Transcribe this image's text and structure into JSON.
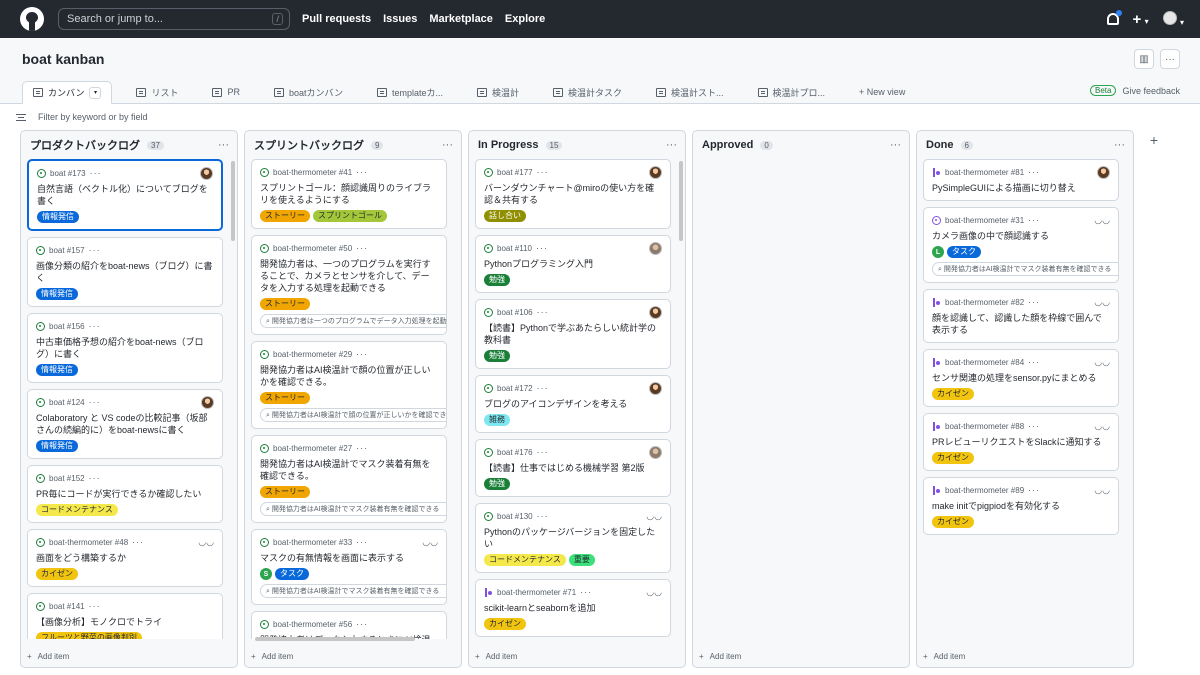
{
  "header": {
    "search_placeholder": "Search or jump to...",
    "search_key": "/",
    "nav": [
      "Pull requests",
      "Issues",
      "Marketplace",
      "Explore"
    ],
    "plus": "+"
  },
  "project": {
    "title": "boat kanban"
  },
  "tabs": [
    {
      "label": "カンバン",
      "active": true
    },
    {
      "label": "リスト"
    },
    {
      "label": "PR"
    },
    {
      "label": "boatカンバン"
    },
    {
      "label": "templateカ..."
    },
    {
      "label": "検温計"
    },
    {
      "label": "検温計タスク"
    },
    {
      "label": "検温計スト..."
    },
    {
      "label": "検温計プロ..."
    }
  ],
  "new_view": "+ New view",
  "beta": "Beta",
  "give_feedback": "Give feedback",
  "filter_placeholder": "Filter by keyword or by field",
  "add_item": "Add item",
  "label_colors": {
    "情報発信": [
      "#0969da",
      "#ffffff"
    ],
    "コードメンテナンス": [
      "#f5e84a",
      "#24292f"
    ],
    "カイゼン": [
      "#f1c40f",
      "#24292f"
    ],
    "フルーツと野菜の画像判別": [
      "#f1c40f",
      "#24292f"
    ],
    "ストーリー": [
      "#f0a500",
      "#24292f"
    ],
    "スプリントゴール": [
      "#a4c639",
      "#24292f"
    ],
    "話し合い": [
      "#8f8f00",
      "#ffffff"
    ],
    "勉強": [
      "#1a7f37",
      "#ffffff"
    ],
    "雑務": [
      "#7ee8f0",
      "#24292f"
    ],
    "重要": [
      "#3ce07a",
      "#24292f"
    ],
    "タスク": [
      "#0969da",
      "#ffffff"
    ]
  },
  "columns": [
    {
      "name": "プロダクトバックログ",
      "count": "37",
      "cards": [
        {
          "type": "issue",
          "ref": "boat #173",
          "avatar": "person",
          "title": "自然言語（ベクトル化）についてブログを書く",
          "labels": [
            "情報発信"
          ],
          "selected": true
        },
        {
          "type": "issue",
          "ref": "boat #157",
          "title": "画像分類の紹介をboat-news（ブログ）に書く",
          "labels": [
            "情報発信"
          ]
        },
        {
          "type": "issue",
          "ref": "boat #156",
          "title": "中古車価格予想の紹介をboat-news（ブログ）に書く",
          "labels": [
            "情報発信"
          ]
        },
        {
          "type": "issue",
          "ref": "boat #124",
          "avatar": "person",
          "title": "Colaboratory と VS codeの比較記事（坂部さんの続編的に）をboat-newsに書く",
          "labels": [
            "情報発信"
          ]
        },
        {
          "type": "issue",
          "ref": "boat #152",
          "title": "PR毎にコードが実行できるか確認したい",
          "labels": [
            "コードメンテナンス"
          ]
        },
        {
          "type": "issue",
          "ref": "boat-thermometer #48",
          "glasses": true,
          "title": "画面をどう構築するか",
          "labels": [
            "カイゼン"
          ]
        },
        {
          "type": "issue",
          "ref": "boat #141",
          "title": "【画像分析】モノクロでトライ",
          "labels": [
            "フルーツと野菜の画像判別"
          ]
        }
      ]
    },
    {
      "name": "スプリントバックログ",
      "count": "9",
      "cards": [
        {
          "type": "issue",
          "ref": "boat-thermometer #41",
          "title": "スプリントゴール：顔認識周りのライブラリを使えるようにする",
          "labels": [
            "ストーリー",
            "スプリントゴール"
          ]
        },
        {
          "type": "issue",
          "ref": "boat-thermometer #50",
          "title": "開発協力者は、一つのプログラムを実行することで、カメラとセンサを介して、データを入力する処理を起動できる",
          "labels": [
            "ストーリー"
          ],
          "linked": "開発協力者は一つのプログラムでデータ入力処理を起動できる"
        },
        {
          "type": "issue",
          "ref": "boat-thermometer #29",
          "title": "開発協力者はAI検温計で顔の位置が正しいかを確認できる。",
          "labels": [
            "ストーリー"
          ],
          "linked": "開発協力者はAI検温計で顔の位置が正しいかを確認できる"
        },
        {
          "type": "issue",
          "ref": "boat-thermometer #27",
          "title": "開発協力者はAI検温計でマスク装着有無を確認できる。",
          "labels": [
            "ストーリー"
          ],
          "linked": "開発協力者はAI検温計でマスク装着有無を確認できる"
        },
        {
          "type": "issue",
          "ref": "boat-thermometer #33",
          "glasses": true,
          "title": "マスクの有無情報を画面に表示する",
          "assignee": "S",
          "labels": [
            "タスク"
          ],
          "linked": "開発協力者はAI検温計でマスク装着有無を確認できる"
        },
        {
          "type": "issue",
          "ref": "boat-thermometer #56",
          "title": "開発協力者はデータ入力するときにAI検温計",
          "labels": []
        }
      ]
    },
    {
      "name": "In Progress",
      "count": "15",
      "cards": [
        {
          "type": "issue",
          "ref": "boat #177",
          "avatar": "multi",
          "title": "バーンダウンチャート@miroの使い方を確認＆共有する",
          "labels": [
            "話し合い"
          ]
        },
        {
          "type": "issue",
          "ref": "boat #110",
          "avatar": "gray",
          "title": "Pythonプログラミング入門",
          "labels": [
            "勉強"
          ]
        },
        {
          "type": "issue",
          "ref": "boat #106",
          "avatar": "person",
          "title": "【読書】Pythonで学ぶあたらしい統計学の教科書",
          "labels": [
            "勉強"
          ]
        },
        {
          "type": "issue",
          "ref": "boat #172",
          "avatar": "person",
          "title": "ブログのアイコンデザインを考える",
          "labels": [
            "雑務"
          ]
        },
        {
          "type": "issue",
          "ref": "boat #176",
          "avatar": "gray",
          "title": "【読書】仕事ではじめる機械学習 第2版",
          "labels": [
            "勉強"
          ]
        },
        {
          "type": "issue",
          "ref": "boat #130",
          "glasses": true,
          "title": "Pythonのパッケージバージョンを固定したい",
          "labels": [
            "コードメンテナンス",
            "重要"
          ]
        },
        {
          "type": "pr",
          "ref": "boat-thermometer #71",
          "glasses": true,
          "title": "scikit-learnとseabornを追加",
          "labels": [
            "カイゼン"
          ]
        }
      ]
    },
    {
      "name": "Approved",
      "count": "0",
      "cards": []
    },
    {
      "name": "Done",
      "count": "6",
      "cards": [
        {
          "type": "pr",
          "ref": "boat-thermometer #81",
          "avatar": "person",
          "title": "PySimpleGUIによる描画に切り替え",
          "labels": []
        },
        {
          "type": "done",
          "ref": "boat-thermometer #31",
          "glasses": true,
          "title": "カメラ画像の中で顔認識する",
          "assignee": "L",
          "labels": [
            "タスク"
          ],
          "linked": "開発協力者はAI検温計でマスク装着有無を確認できる"
        },
        {
          "type": "pr",
          "ref": "boat-thermometer #82",
          "glasses": true,
          "title": "顔を認識して、認識した顔を枠線で囲んで表示する",
          "labels": []
        },
        {
          "type": "pr",
          "ref": "boat-thermometer #84",
          "glasses": true,
          "title": "センサ関連の処理をsensor.pyにまとめる",
          "labels": [
            "カイゼン"
          ]
        },
        {
          "type": "pr",
          "ref": "boat-thermometer #88",
          "glasses": true,
          "title": "PRレビューリクエストをSlackに通知する",
          "labels": [
            "カイゼン"
          ]
        },
        {
          "type": "pr",
          "ref": "boat-thermometer #89",
          "glasses": true,
          "title": "make initでpigpiodを有効化する",
          "labels": [
            "カイゼン"
          ]
        }
      ]
    }
  ]
}
